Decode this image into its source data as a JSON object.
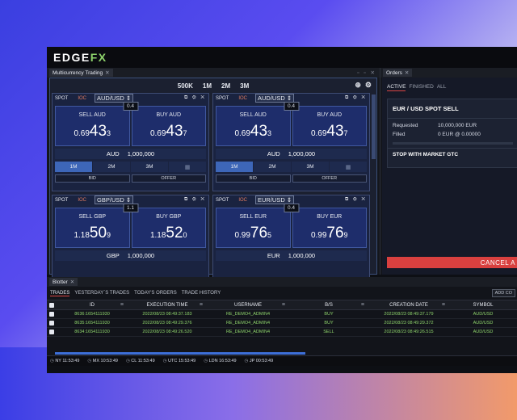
{
  "app": {
    "logo_left": "EDGE",
    "logo_right": "FX"
  },
  "mct_tab": {
    "title": "Multicurrency Trading",
    "close": "✕",
    "winctl": "▫ ▫ ✕"
  },
  "notionals": [
    "500K",
    "1M",
    "2M",
    "3M"
  ],
  "tiles": [
    {
      "type": "SPOT",
      "ioc": "IOC",
      "pair": "AUD/USD ⇕",
      "ctl": "⧉ ⚙ ✕",
      "spread": "0.4",
      "sell_label": "SELL AUD",
      "sell_pre": "0.69",
      "sell_big": "43",
      "sell_pip": "3",
      "buy_label": "BUY AUD",
      "buy_pre": "0.69",
      "buy_big": "43",
      "buy_pip": "7",
      "ccy": "AUD",
      "amount": "1,000,000",
      "tenors": [
        "1M",
        "2M",
        "3M",
        "▦"
      ],
      "bid": "BID",
      "offer": "OFFER"
    },
    {
      "type": "SPOT",
      "ioc": "IOC",
      "pair": "AUD/USD ⇕",
      "ctl": "⧉ ⚙ ✕",
      "spread": "0.4",
      "sell_label": "SELL AUD",
      "sell_pre": "0.69",
      "sell_big": "43",
      "sell_pip": "3",
      "buy_label": "BUY AUD",
      "buy_pre": "0.69",
      "buy_big": "43",
      "buy_pip": "7",
      "ccy": "AUD",
      "amount": "1,000,000",
      "tenors": [
        "1M",
        "2M",
        "3M",
        "▦"
      ],
      "bid": "BID",
      "offer": "OFFER"
    },
    {
      "type": "SPOT",
      "ioc": "IOC",
      "pair": "GBP/USD ⇕",
      "ctl": "⧉ ⚙ ✕",
      "spread": "1.1",
      "sell_label": "SELL GBP",
      "sell_pre": "1.18",
      "sell_big": "50",
      "sell_pip": "9",
      "buy_label": "BUY GBP",
      "buy_pre": "1.18",
      "buy_big": "52",
      "buy_pip": "0",
      "ccy": "GBP",
      "amount": "1,000,000"
    },
    {
      "type": "SPOT",
      "ioc": "IOC",
      "pair": "EUR/USD ⇕",
      "ctl": "⧉ ⚙ ✕",
      "spread": "0.4",
      "sell_label": "SELL EUR",
      "sell_pre": "0.99",
      "sell_big": "76",
      "sell_pip": "5",
      "buy_label": "BUY EUR",
      "buy_pre": "0.99",
      "buy_big": "76",
      "buy_pip": "9",
      "ccy": "EUR",
      "amount": "1,000,000"
    }
  ],
  "orders": {
    "tab": "Orders",
    "close": "✕",
    "tabs": [
      "ACTIVE",
      "FINISHED",
      "ALL"
    ],
    "title": "EUR / USD SPOT SELL",
    "requested_label": "Requested",
    "requested_value": "10,000,000 EUR",
    "filled_label": "Filled",
    "filled_value": "0 EUR @ 0.00000",
    "stop": "STOP WITH MARKET GTC",
    "cancel": "CANCEL A"
  },
  "blotter": {
    "tab": "Blotter",
    "close": "✕",
    "tabs": [
      "TRADES",
      "YESTERDAY`S TRADES",
      "TODAY'S ORDERS",
      "TRADE HISTORY"
    ],
    "add": "ADD CO",
    "columns": [
      "ID",
      "EXECUTION TIME",
      "USERNAME",
      "B/S",
      "CREATION DATE",
      "SYMBOL"
    ],
    "menu_icon": "≡",
    "rows": [
      {
        "id": "8636:1654111930",
        "time": "2022/08/23 08:49:37.183",
        "user": "RE_DEMO4_ADMIN4",
        "bs": "BUY",
        "date": "2022/08/23 08:49:37.179",
        "sym": "AUD/USD"
      },
      {
        "id": "8635:1654111930",
        "time": "2022/08/23 08:49:29.376",
        "user": "RE_DEMO4_ADMIN4",
        "bs": "BUY",
        "date": "2022/08/23 08:49:29.372",
        "sym": "AUD/USD"
      },
      {
        "id": "8634:1654111930",
        "time": "2022/08/23 08:49:26.520",
        "user": "RE_DEMO4_ADMIN4",
        "bs": "SELL",
        "date": "2022/08/23 08:49:26.515",
        "sym": "AUD/USD"
      }
    ]
  },
  "clocks": [
    {
      "tz": "NY",
      "time": "11:53:49"
    },
    {
      "tz": "MX",
      "time": "10:53:49"
    },
    {
      "tz": "CL",
      "time": "11:53:49"
    },
    {
      "tz": "UTC",
      "time": "15:53:49"
    },
    {
      "tz": "LDN",
      "time": "16:53:49"
    },
    {
      "tz": "JP",
      "time": "00:53:49"
    }
  ]
}
